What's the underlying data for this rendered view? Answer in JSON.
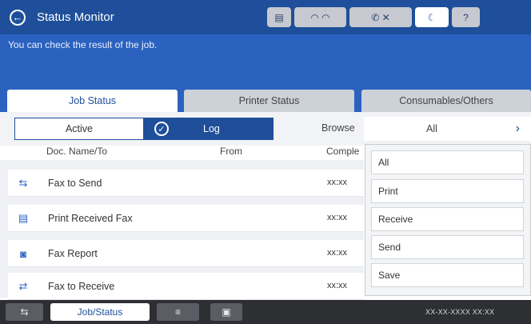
{
  "header": {
    "title": "Status Monitor",
    "subtitle": "You can check the result of the job."
  },
  "tabs": [
    {
      "label": "Job Status",
      "active": true
    },
    {
      "label": "Printer Status",
      "active": false
    },
    {
      "label": "Consumables/Others",
      "active": false
    }
  ],
  "filter": {
    "active_label": "Active",
    "log_label": "Log",
    "browse_label": "Browse",
    "browse_value": "All",
    "browse_chevron": "›"
  },
  "table": {
    "headers": {
      "doc": "Doc. Name/To",
      "from": "From",
      "complete": "Comple"
    },
    "rows": [
      {
        "name": "Fax to Send",
        "time": "xx:xx",
        "icon": "fax-send-icon"
      },
      {
        "name": "Print Received Fax",
        "time": "xx:xx",
        "icon": "print-fax-icon"
      },
      {
        "name": "Fax Report",
        "time": "xx:xx",
        "icon": "fax-report-icon"
      },
      {
        "name": "Fax to Receive",
        "time": "xx:xx",
        "icon": "fax-receive-icon"
      }
    ]
  },
  "dropdown": {
    "options": [
      "All",
      "Print",
      "Receive",
      "Send",
      "Save"
    ]
  },
  "bottom": {
    "job_status_label": "Job/Status",
    "datetime": "XX-XX-XXXX XX:XX"
  },
  "colors": {
    "header": "#1f4f9a",
    "accent": "#2b62c0",
    "bottom_bar": "#2d2f33"
  }
}
